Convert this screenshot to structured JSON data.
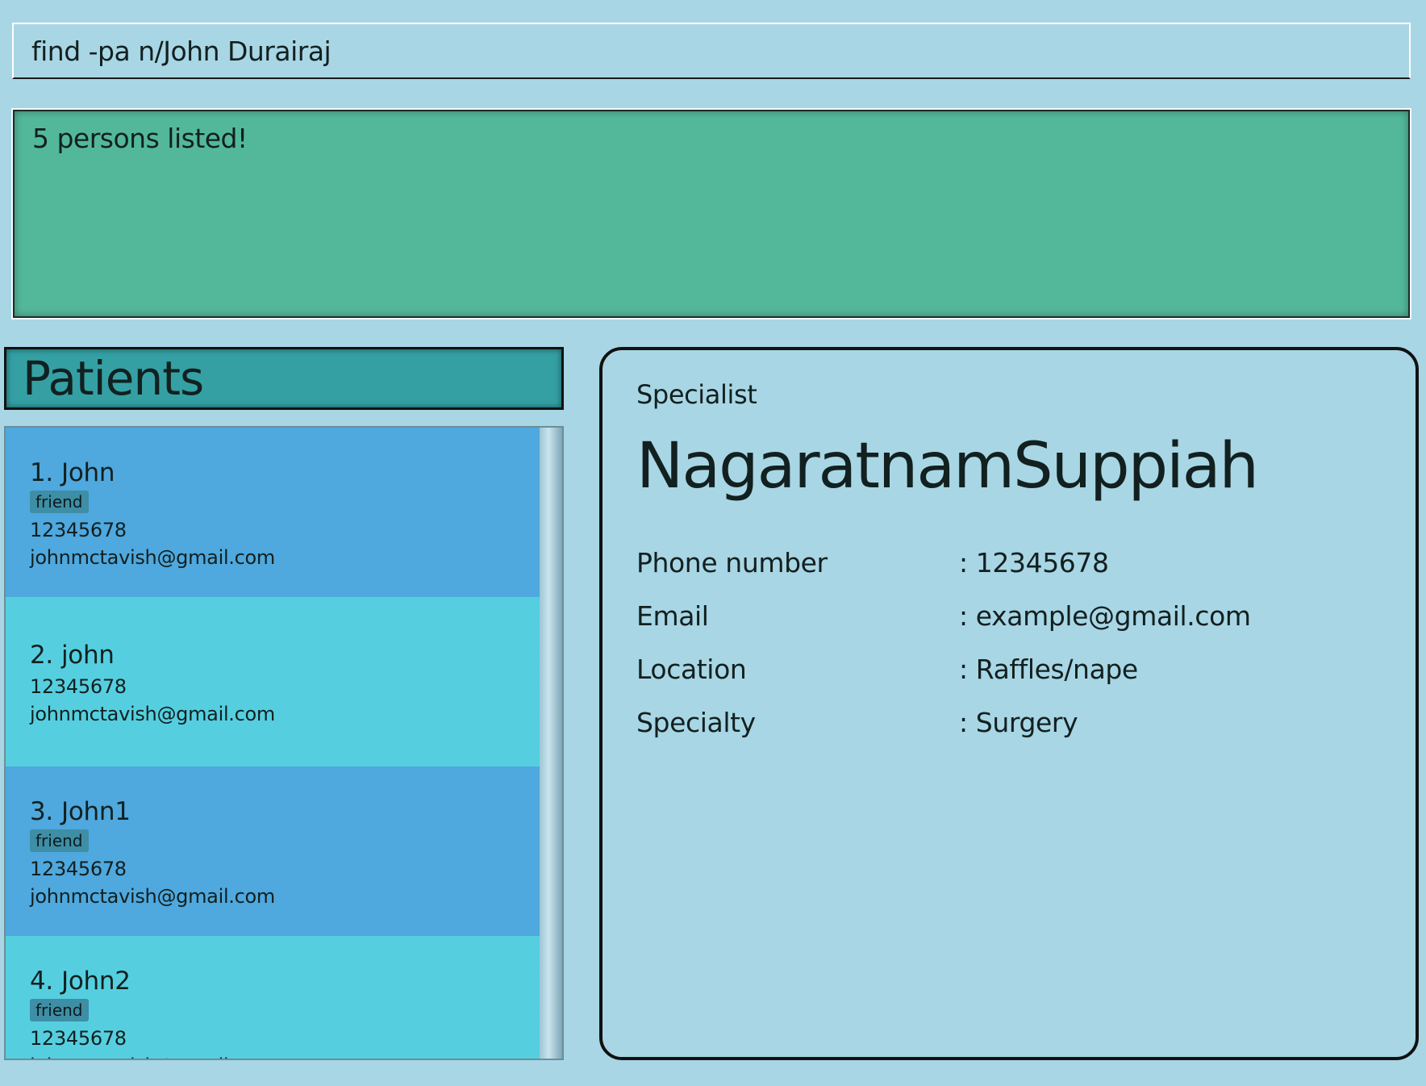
{
  "command": {
    "value": "find -pa n/John Durairaj"
  },
  "result": {
    "message": "5 persons listed!"
  },
  "patients": {
    "title": "Patients",
    "items": [
      {
        "index": "1.",
        "name": "John",
        "tag": "friend",
        "phone": "12345678",
        "email": "johnmctavish@gmail.com"
      },
      {
        "index": "2.",
        "name": "john",
        "phone": "12345678",
        "email": "johnmctavish@gmail.com"
      },
      {
        "index": "3.",
        "name": "John1",
        "tag": "friend",
        "phone": "12345678",
        "email": "johnmctavish@gmail.com"
      },
      {
        "index": "4.",
        "name": "John2",
        "tag": "friend",
        "phone": "12345678",
        "email": "johnmctavish@gmail.com"
      }
    ]
  },
  "detail": {
    "kind": "Specialist",
    "name": "NagaratnamSuppiah",
    "rows": [
      {
        "label": "Phone number",
        "value": ": 12345678"
      },
      {
        "label": "Email",
        "value": ": example@gmail.com"
      },
      {
        "label": "Location",
        "value": ": Raffles/nape"
      },
      {
        "label": "Specialty",
        "value": ": Surgery"
      }
    ]
  },
  "colors": {
    "background": "#a8d6e5",
    "result_bg": "#53b89a",
    "header_bg": "#34a0a4",
    "card_odd": "#4fa8de",
    "card_even": "#55cfe0",
    "tag_bg": "#3e8ea5"
  }
}
